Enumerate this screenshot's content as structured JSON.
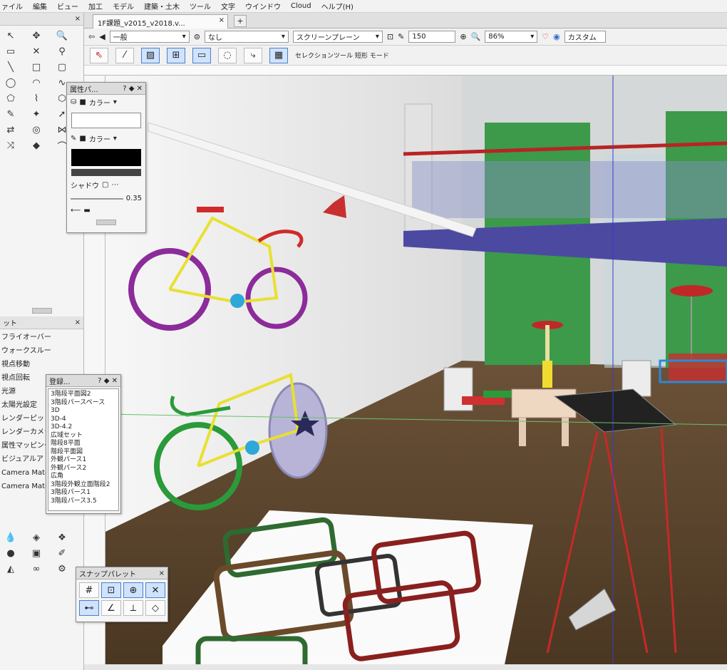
{
  "menu": [
    "ァイル",
    "編集",
    "ビュー",
    "加工",
    "モデル",
    "建築・土木",
    "ツール",
    "文字",
    "ウインドウ",
    "Cloud",
    "ヘルプ(H)"
  ],
  "tab": {
    "label": "1F課題_v2015_v2018.v...",
    "close": "×",
    "add": "+"
  },
  "toolbar1": {
    "class_select": "一般",
    "layer_select": "なし",
    "plane_select": "スクリーンプレーン",
    "zoom_value": "150",
    "scale_select": "86%",
    "view_select": "カスタム"
  },
  "toolbar2": {
    "mode_label": "セレクションツール 短形 モード"
  },
  "attr_palette": {
    "title": "属性パ...",
    "help": "?",
    "fill_label": "カラー",
    "pen_label": "カラー",
    "shadow_label": "シャドウ",
    "opacity_value": "0.35"
  },
  "left_panel": {
    "close": "×",
    "section_head": "ット",
    "items": [
      "フライオーバー",
      "ウォークスルー",
      "視点移動",
      "視点回転",
      "光源",
      "太陽光設定",
      "レンダーピットマ",
      "レンダーカメラ",
      "属性マッピング",
      "ビジュアルア",
      "Camera Match(ック)",
      "Camera Match(シャドウ)"
    ]
  },
  "registry_palette": {
    "title": "登録...",
    "help": "?",
    "items": [
      "3階段平面図2",
      "3階段パースペース",
      "3D",
      "3D-4",
      "3D-4.2",
      "広域セット",
      "階段8平面",
      "階段平面図",
      "外観パース1",
      "外観パース2",
      "広角",
      "3階段外観立面階段2",
      "3階段パース1",
      "3階段パース3.5"
    ]
  },
  "snap_palette": {
    "title": "スナップパレット",
    "close": "×"
  },
  "colors": {
    "accent": "#4a80c8",
    "wall": "#efefef",
    "floor": "#5a4530",
    "green": "#3c9a4a",
    "deck": "#4b4aa0"
  }
}
